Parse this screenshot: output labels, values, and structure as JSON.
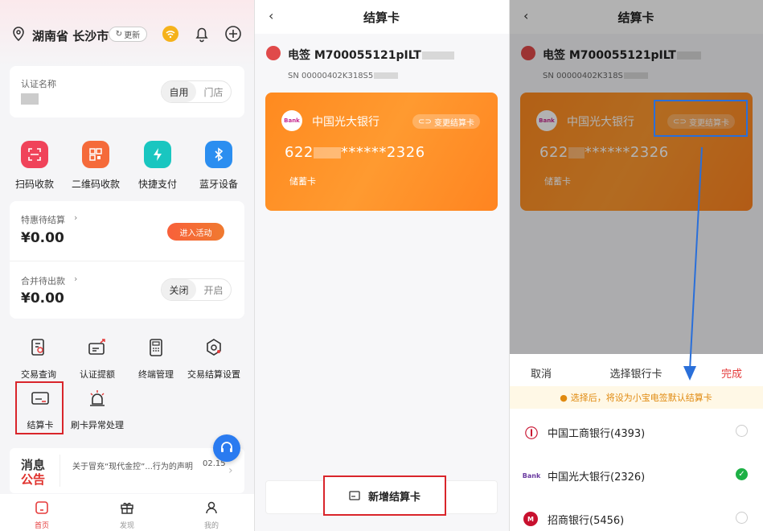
{
  "panel1": {
    "location": "湖南省 长沙市",
    "refresh_label": "更新",
    "auth_label": "认证名称",
    "auth_value": "t",
    "auth_toggle": [
      "自用",
      "门店"
    ],
    "quick_actions": [
      "扫码收款",
      "二维码收款",
      "快捷支付",
      "蓝牙设备"
    ],
    "promo": {
      "label": "特惠待结算",
      "amount": "¥0.00",
      "button": "进入活动"
    },
    "merge": {
      "label": "合并待出款",
      "amount": "¥0.00",
      "toggle": [
        "关闭",
        "开启"
      ]
    },
    "tools_row1": [
      "交易查询",
      "认证提额",
      "终端管理",
      "交易结算设置"
    ],
    "tools_row2": [
      "结算卡",
      "刷卡异常处理"
    ],
    "message": {
      "logo_top": "消息",
      "logo_bottom": "公告",
      "text": "关于冒充“现代金控”...行为的声明",
      "time": "02.15"
    },
    "tabs": [
      "首页",
      "发现",
      "我的"
    ]
  },
  "panel2": {
    "back": "‹",
    "title": "结算卡",
    "device_name": "电签 M700055121pILT",
    "device_sn": "SN 00000402K318S5",
    "card": {
      "bank_logo": "Bank",
      "bank": "中国光大银行",
      "change": "变更结算卡",
      "number_prefix": "622",
      "number_suffix": "******2326",
      "type": "储蓄卡"
    },
    "add_button": "新增结算卡"
  },
  "panel3": {
    "back": "‹",
    "title": "结算卡",
    "device_name": "电签 M700055121pILT",
    "device_sn": "SN 00000402K318S",
    "card": {
      "bank_logo": "Bank",
      "bank": "中国光大银行",
      "change": "变更结算卡",
      "number_prefix": "622",
      "number_suffix": "******2326",
      "type": "储蓄卡"
    },
    "sheet": {
      "cancel": "取消",
      "title": "选择银行卡",
      "done": "完成",
      "notice": "选择后，将设为小宝电签默认结算卡",
      "banks": [
        {
          "name": "中国工商银行(4393)",
          "selected": false,
          "icon": "Ⓘ"
        },
        {
          "name": "中国光大银行(2326)",
          "selected": true,
          "icon": "Bank"
        },
        {
          "name": "招商银行(5456)",
          "selected": false,
          "icon": "M"
        }
      ]
    }
  },
  "colors": {
    "accent_red": "#d9252b",
    "card_orange": "#ff8a1f",
    "highlight_blue": "#2a6fd9",
    "check_green": "#1db045"
  }
}
